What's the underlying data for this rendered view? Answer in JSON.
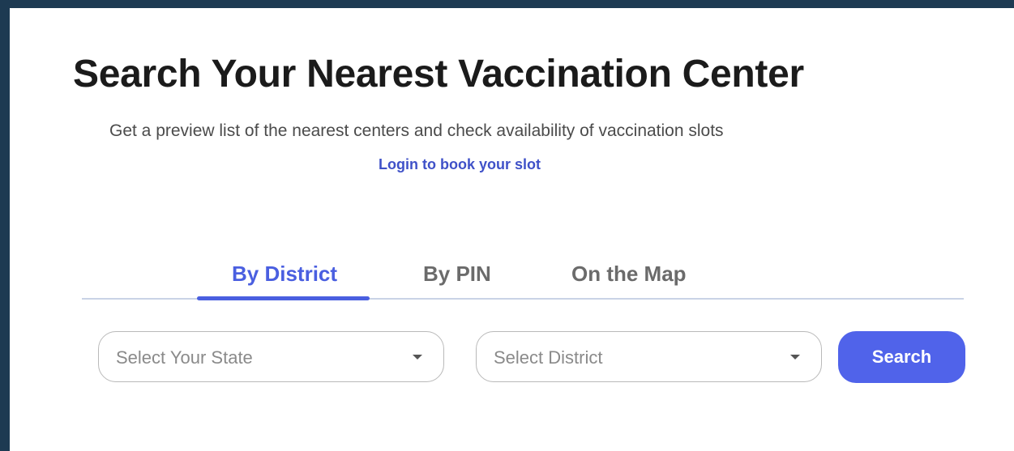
{
  "header": {
    "title": "Search Your Nearest Vaccination Center",
    "subtitle": "Get a preview list of the nearest centers and check availability of vaccination slots",
    "login_link": "Login to book your slot"
  },
  "tabs": [
    {
      "label": "By District",
      "active": true
    },
    {
      "label": "By PIN",
      "active": false
    },
    {
      "label": "On the Map",
      "active": false
    }
  ],
  "search_form": {
    "state_select": {
      "placeholder": "Select Your State"
    },
    "district_select": {
      "placeholder": "Select District"
    },
    "search_button_label": "Search"
  },
  "colors": {
    "accent": "#4a5fe0",
    "button": "#5063ea",
    "link": "#3f51c8",
    "frame": "#1d3a52"
  }
}
